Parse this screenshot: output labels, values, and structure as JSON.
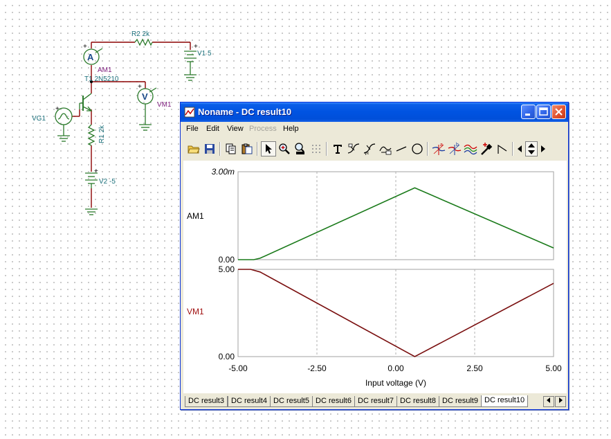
{
  "schematic": {
    "r2_label": "R2 2k",
    "v1_label": "V1 5",
    "am1_label": "AM1",
    "transistor_label": "T1 2N5210",
    "vm1_label": "VM1",
    "vg1_label": "VG1",
    "r1_label": "R1 2k",
    "v2_label": "V2 -5",
    "ammeter_symbol": "A",
    "voltmeter_symbol": "V",
    "plus_sign": "+"
  },
  "window": {
    "title": "Noname - DC result10",
    "title_color": "#ffffff",
    "menu": [
      {
        "label": "File",
        "enabled": true
      },
      {
        "label": "Edit",
        "enabled": true
      },
      {
        "label": "View",
        "enabled": true
      },
      {
        "label": "Process",
        "enabled": false
      },
      {
        "label": "Help",
        "enabled": true
      }
    ],
    "toolbar_icons": [
      "open-icon",
      "save-icon",
      "copy-icon",
      "paste-icon",
      "pointer-icon",
      "zoom-in-icon",
      "zoom-100-icon",
      "grid-icon",
      "text-icon",
      "curve-label-icon",
      "curve-label2-icon",
      "curve-label3-icon",
      "line-icon",
      "circle-icon",
      "cursor-a-icon",
      "cursor-b-icon",
      "curves-icon",
      "marker-icon",
      "slope-icon",
      "nav-left-icon",
      "nav-updown-icon",
      "nav-right-icon"
    ],
    "tabs": [
      "DC result3",
      "DC result4",
      "DC result5",
      "DC result6",
      "DC result7",
      "DC result8",
      "DC result9",
      "DC result10"
    ],
    "active_tab": "DC result10"
  },
  "chart_data": [
    {
      "type": "line",
      "ylabel": "AM1",
      "ylabel_color": "#000000",
      "series": [
        {
          "name": "AM1",
          "color": "#1a7a1a",
          "x": [
            -5.0,
            -4.5,
            -4.3,
            0.6,
            5.0
          ],
          "y": [
            0.0,
            0.0,
            0.05,
            2.45,
            0.4
          ]
        }
      ],
      "xlim": [
        -5.0,
        5.0
      ],
      "ylim": [
        0.0,
        3.0
      ],
      "ytick_labels": [
        "3.00m",
        "0.00"
      ],
      "grid_x": [
        -2.5,
        0.0,
        2.5
      ]
    },
    {
      "type": "line",
      "ylabel": "VM1",
      "ylabel_color": "#a01010",
      "series": [
        {
          "name": "VM1",
          "color": "#7a0f0f",
          "x": [
            -5.0,
            -4.6,
            -4.3,
            0.6,
            5.0
          ],
          "y": [
            5.0,
            5.0,
            4.85,
            0.0,
            4.2
          ]
        }
      ],
      "xlim": [
        -5.0,
        5.0
      ],
      "ylim": [
        0.0,
        5.0
      ],
      "ytick_labels": [
        "5.00",
        "0.00"
      ],
      "xtick_labels": [
        "-5.00",
        "-2.50",
        "0.00",
        "2.50",
        "5.00"
      ],
      "xticks": [
        -5.0,
        -2.5,
        0.0,
        2.5,
        5.0
      ],
      "xlabel": "Input voltage (V)",
      "grid_x": [
        -2.5,
        0.0,
        2.5
      ]
    }
  ]
}
